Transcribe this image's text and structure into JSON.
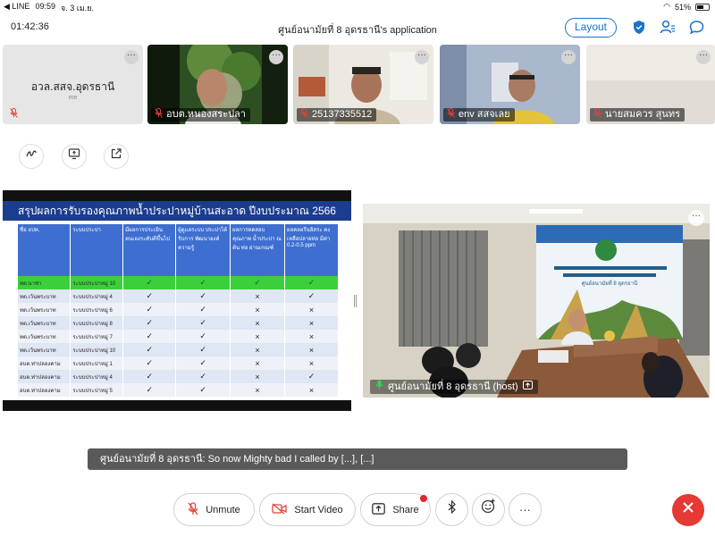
{
  "status_bar": {
    "app": "◀ LINE",
    "time": "09:59",
    "date": "จ. 3 เม.ย.",
    "battery": "51%"
  },
  "header": {
    "timer": "01:42:36",
    "title": "ศูนย์อนามัยที่ 8 อุดรธานี's application",
    "layout_label": "Layout"
  },
  "participants": [
    {
      "name": "อวล.สสจ.อุดรธานี",
      "subtitle": "me",
      "video": false
    },
    {
      "name": "อบต.หนองสระปลา",
      "video": true
    },
    {
      "name": "25137335512",
      "video": true
    },
    {
      "name": "env สสจเลย",
      "video": true
    },
    {
      "name": "นายสมควร สุนทร",
      "video": true
    }
  ],
  "slide": {
    "title": "สรุปผลการรับรองคุณภาพน้ำประปาหมู่บ้านสะอาด ปีงบประมาณ 2566",
    "headers": [
      "ชื่อ อปท.",
      "ระบบประปา",
      "มีผลการประเมิน ตนเองระดับดีขึ้นไป",
      "ผู้ดูแลระบบ ประปาได้รับการ พัฒนาองค์ ความรู้",
      "ผลการทดสอบ คุณภาพ น้ำประปา ณ ต้น ท่อ ผ่านเกณฑ์",
      "ผลคลอรีนอิสระ คงเหลือปลายท่อ มีค่า 0.2-0.5 ppm"
    ],
    "rows": [
      [
        "ทต.นาซ่า",
        "ระบบประปาหมู่ 10",
        "✓",
        "✓",
        "✓",
        "✓"
      ],
      [
        "ทต.เว้นพระบาท",
        "ระบบประปาหมู่ 4",
        "✓",
        "✓",
        "×",
        "✓"
      ],
      [
        "ทต.เว้นพระบาท",
        "ระบบประปาหมู่ 6",
        "✓",
        "✓",
        "×",
        "×"
      ],
      [
        "ทต.เว้นพระบาท",
        "ระบบประปาหมู่ 8",
        "✓",
        "✓",
        "×",
        "×"
      ],
      [
        "ทต.เว้นพระบาท",
        "ระบบประปาหมู่ 7",
        "✓",
        "✓",
        "×",
        "×"
      ],
      [
        "ทต.เว้นพระบาท",
        "ระบบประปาหมู่ 10",
        "✓",
        "✓",
        "×",
        "×"
      ],
      [
        "อบต.ท่าปลองคาม",
        "ระบบประปาหมู่ 1",
        "✓",
        "✓",
        "×",
        "×"
      ],
      [
        "อบต.ท่าปลองคาม",
        "ระบบประปาหมู่ 4",
        "✓",
        "✓",
        "×",
        "✓"
      ],
      [
        "อบต.ท่าปลองคาม",
        "ระบบประปาหมู่ 5",
        "✓",
        "✓",
        "×",
        "×"
      ]
    ]
  },
  "host_video": {
    "name": "ศูนย์อนามัยที่ 8 อุดรธานี (host)",
    "backdrop_text": "ศูนย์อนามัยที่ 8 อุดรธานี"
  },
  "caption": "ศูนย์อนามัยที่ 8 อุดรธานี: So now Mighty bad I called by [...], [...]",
  "toolbar": {
    "unmute": "Unmute",
    "start_video": "Start Video",
    "share": "Share",
    "more": "···"
  },
  "colors": {
    "accent": "#1a73c8",
    "leave": "#e53935",
    "mic_off": "#e0423b",
    "slide_header": "#1b3d8f"
  }
}
